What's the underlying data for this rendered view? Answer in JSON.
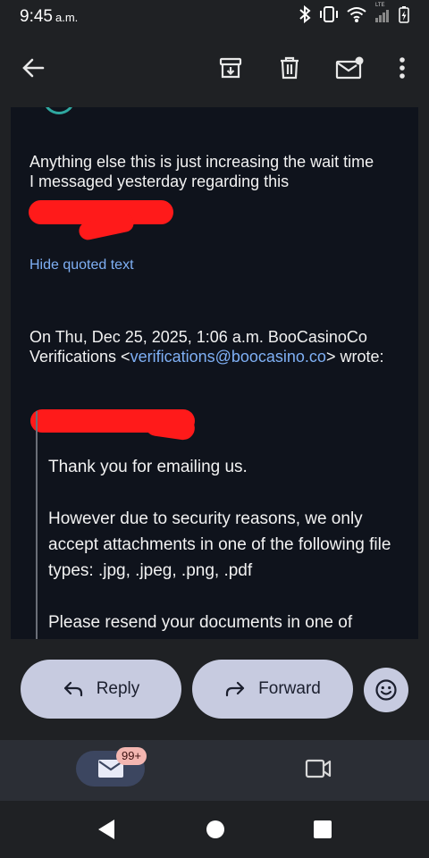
{
  "status_bar": {
    "time": "9:45",
    "ampm": "a.m.",
    "network_label": "LTE",
    "icons": [
      "bluetooth-icon",
      "vibrate-icon",
      "wifi-icon",
      "signal-icon",
      "battery-charging-icon"
    ]
  },
  "toolbar": {
    "back_icon": "arrow-left-icon",
    "actions": [
      "archive-icon",
      "delete-icon",
      "mark-unread-icon",
      "more-vert-icon"
    ]
  },
  "email": {
    "reply_line1": "Anything else this is just increasing the wait time",
    "reply_line2": "I messaged yesterday regarding this",
    "hide_quoted": "Hide quoted text",
    "attribution_prefix": "On Thu, Dec 25, 2025, 1:06 a.m. BooCasinoCo Verifications <",
    "attribution_email": "verifications@boocasino.co",
    "attribution_suffix": "> wrote:",
    "quoted_p1": "Thank you for emailing us.",
    "quoted_p2": "However due to security reasons, we only accept attachments in one of the following file types: .jpg, .jpeg, .png, .pdf",
    "quoted_p3": "Please resend your documents in one of"
  },
  "actions": {
    "reply_label": "Reply",
    "forward_label": "Forward",
    "emoji_icon": "emoji-reaction-icon"
  },
  "bottom_nav": {
    "mail_badge": "99+",
    "items": [
      "mail-icon",
      "video-call-icon"
    ]
  },
  "system_nav": [
    "back-triangle-icon",
    "home-circle-icon",
    "recents-square-icon"
  ],
  "colors": {
    "background": "#1f2124",
    "card": "#0f131c",
    "link": "#7fb0f5",
    "pill": "#c7cbe0",
    "redaction": "#ff1a1a",
    "badge": "#f3b6b1"
  }
}
